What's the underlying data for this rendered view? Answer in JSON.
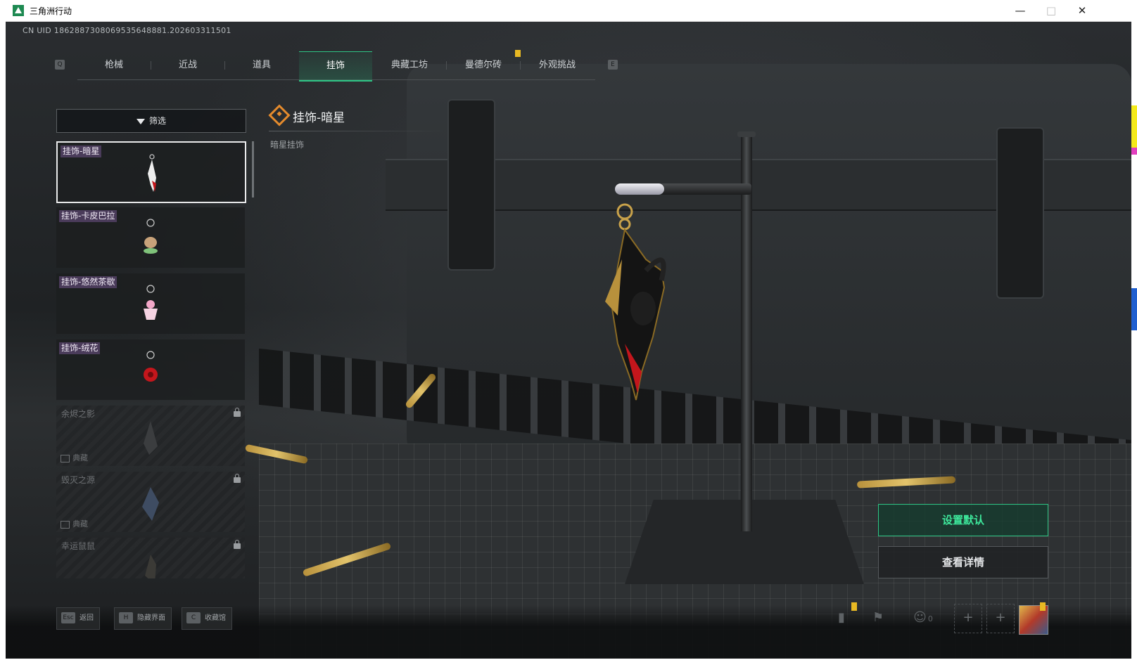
{
  "window": {
    "title": "三角洲行动",
    "min": "—",
    "max": "□",
    "close": "✕"
  },
  "uid": "CN UID 1862887308069535648881.202603311501",
  "tabs": {
    "left_key": "Q",
    "right_key": "E",
    "items": [
      "枪械",
      "近战",
      "道具",
      "挂饰",
      "典藏工坊",
      "曼德尔砖",
      "外观挑战"
    ],
    "active_index": 3
  },
  "filter": {
    "label": "筛选"
  },
  "items": [
    {
      "label": "挂饰-暗星",
      "selected": true,
      "locked": false
    },
    {
      "label": "挂饰-卡皮巴拉",
      "selected": false,
      "locked": false
    },
    {
      "label": "挂饰-悠然茶歇",
      "selected": false,
      "locked": false
    },
    {
      "label": "挂饰-绒花",
      "selected": false,
      "locked": false
    },
    {
      "label": "余烬之影",
      "selected": false,
      "locked": true,
      "tag": "典藏"
    },
    {
      "label": "毁灭之源",
      "selected": false,
      "locked": true,
      "tag": "典藏"
    },
    {
      "label": "幸运鼠鼠",
      "selected": false,
      "locked": true
    }
  ],
  "detail": {
    "title": "挂饰-暗星",
    "subtitle": "暗星挂饰"
  },
  "actions": {
    "set_default": "设置默认",
    "view_detail": "查看详情"
  },
  "hotkeys": [
    {
      "key": "Esc",
      "label": "返回"
    },
    {
      "key": "H",
      "label": "隐藏界面"
    },
    {
      "key": "C",
      "label": "收藏馆"
    }
  ],
  "status": {
    "friends_count": "0"
  },
  "colors": {
    "accent": "#2ec585",
    "marker": "#e8b923",
    "tag_bg": "#5a466e",
    "item_icon": "#e58b2d"
  }
}
